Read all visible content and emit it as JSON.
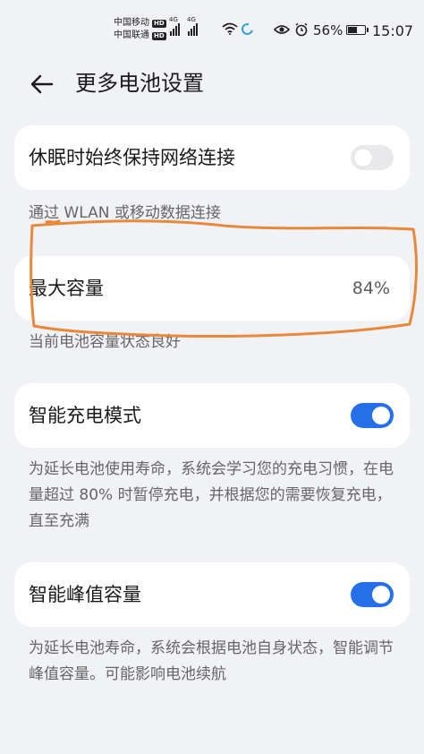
{
  "status_bar": {
    "carrier_1": "中国移动",
    "carrier_2": "中国联通",
    "hd_badge": "HD",
    "signal_tag": "4G",
    "battery_text": "56%",
    "battery_level": 0.56,
    "time": "15:07",
    "icons": [
      "signal-icon",
      "wifi-icon",
      "moon-icon",
      "eye-icon",
      "alarm-icon",
      "battery-icon"
    ]
  },
  "header": {
    "title": "更多电池设置",
    "back_icon": "arrow-left-icon"
  },
  "settings": [
    {
      "label": "休眠时始终保持网络连接",
      "type": "toggle",
      "enabled": false,
      "description": "通过 WLAN 或移动数据连接"
    },
    {
      "label": "最大容量",
      "type": "value",
      "value": "84%",
      "description": "当前电池容量状态良好"
    },
    {
      "label": "智能充电模式",
      "type": "toggle",
      "enabled": true,
      "description": "为延长电池使用寿命，系统会学习您的充电习惯，在电量超过 80% 时暂停充电，并根据您的需要恢复充电，直至充满"
    },
    {
      "label": "智能峰值容量",
      "type": "toggle",
      "enabled": true,
      "description": "为延长电池寿命，系统会根据电池自身状态，智能调节峰值容量。可能影响电池续航"
    }
  ],
  "colors": {
    "background": "#f1f2f6",
    "card": "#ffffff",
    "toggle_on": "#256fe8",
    "toggle_off": "#e9e9ec",
    "annotation": "#e8883a"
  }
}
